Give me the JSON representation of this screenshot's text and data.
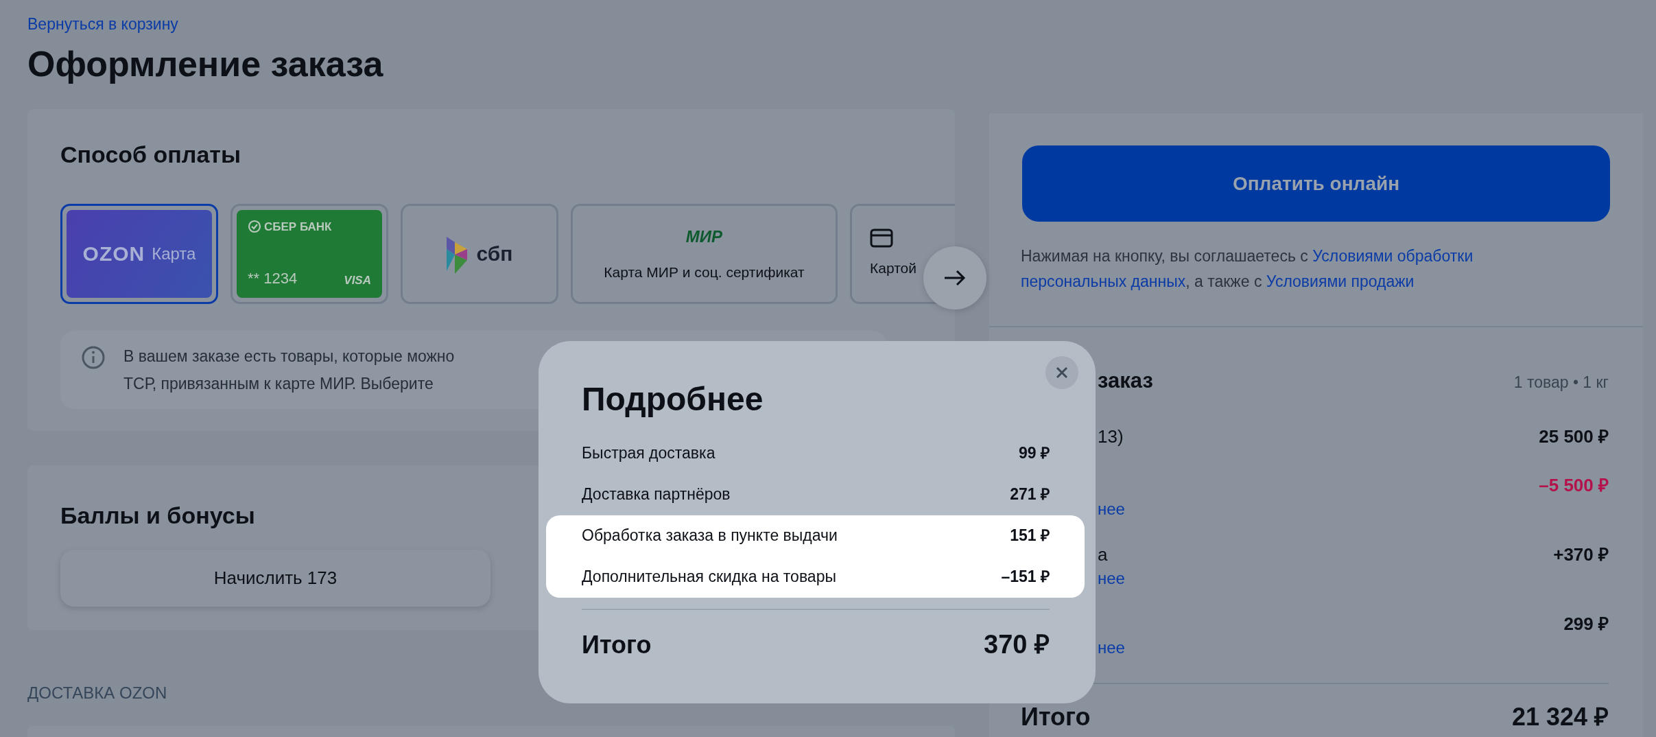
{
  "back_link": "Вернуться в корзину",
  "title": "Оформление заказа",
  "payment": {
    "heading": "Способ оплаты",
    "methods": [
      {
        "kind": "ozon",
        "selected": true,
        "brand": "OZON",
        "label": "Карта"
      },
      {
        "kind": "sber",
        "selected": false,
        "brand": "СБЕР БАНК",
        "number": "** 1234",
        "network": "VISA"
      },
      {
        "kind": "sbp",
        "selected": false,
        "brand": "сбп"
      },
      {
        "kind": "mir",
        "selected": false,
        "brand": "МИР",
        "label": "Карта МИР и соц. сертификат"
      },
      {
        "kind": "card",
        "selected": false,
        "label": "Картой"
      }
    ],
    "info_lines": [
      "В вашем заказе есть товары, которые можно",
      "ТСР, привязанным к карте МИР.  Выберите"
    ]
  },
  "bonuses": {
    "heading": "Баллы и бонусы",
    "button": "Начислить 173"
  },
  "delivery_section": "ДОСТАВКА OZON",
  "checkout": {
    "pay_button": "Оплатить онлайн",
    "terms_before": "Нажимая на кнопку, вы соглашаетесь с",
    "terms_link_1": "Условиями обработки персональных данных",
    "terms_middle": ", а также с",
    "terms_link_2": "Условиями продажи"
  },
  "order": {
    "heading": "заказ",
    "meta": "1 товар • 1 кг",
    "rows": [
      {
        "kind": "plain",
        "label": "13)",
        "value": "25 500 ₽"
      },
      {
        "kind": "discount",
        "value": "–5 500 ₽",
        "link": "нее"
      },
      {
        "kind": "plain",
        "label": "а",
        "value": "+370 ₽",
        "link": "нее"
      },
      {
        "kind": "plain",
        "value": "299 ₽",
        "link": "нее"
      }
    ],
    "total_label": "Итого",
    "total": "21 324 ₽"
  },
  "modal": {
    "title": "Подробнее",
    "rows": [
      {
        "label": "Быстрая доставка",
        "value": "99 ₽",
        "highlighted": false
      },
      {
        "label": "Доставка партнёров",
        "value": "271 ₽",
        "highlighted": false
      },
      {
        "label": "Обработка заказа в пункте выдачи",
        "value": "151 ₽",
        "highlighted": true
      },
      {
        "label": "Дополнительная скидка на товары",
        "value": "–151 ₽",
        "highlighted": true
      }
    ],
    "total_label": "Итого",
    "total": "370 ₽"
  }
}
